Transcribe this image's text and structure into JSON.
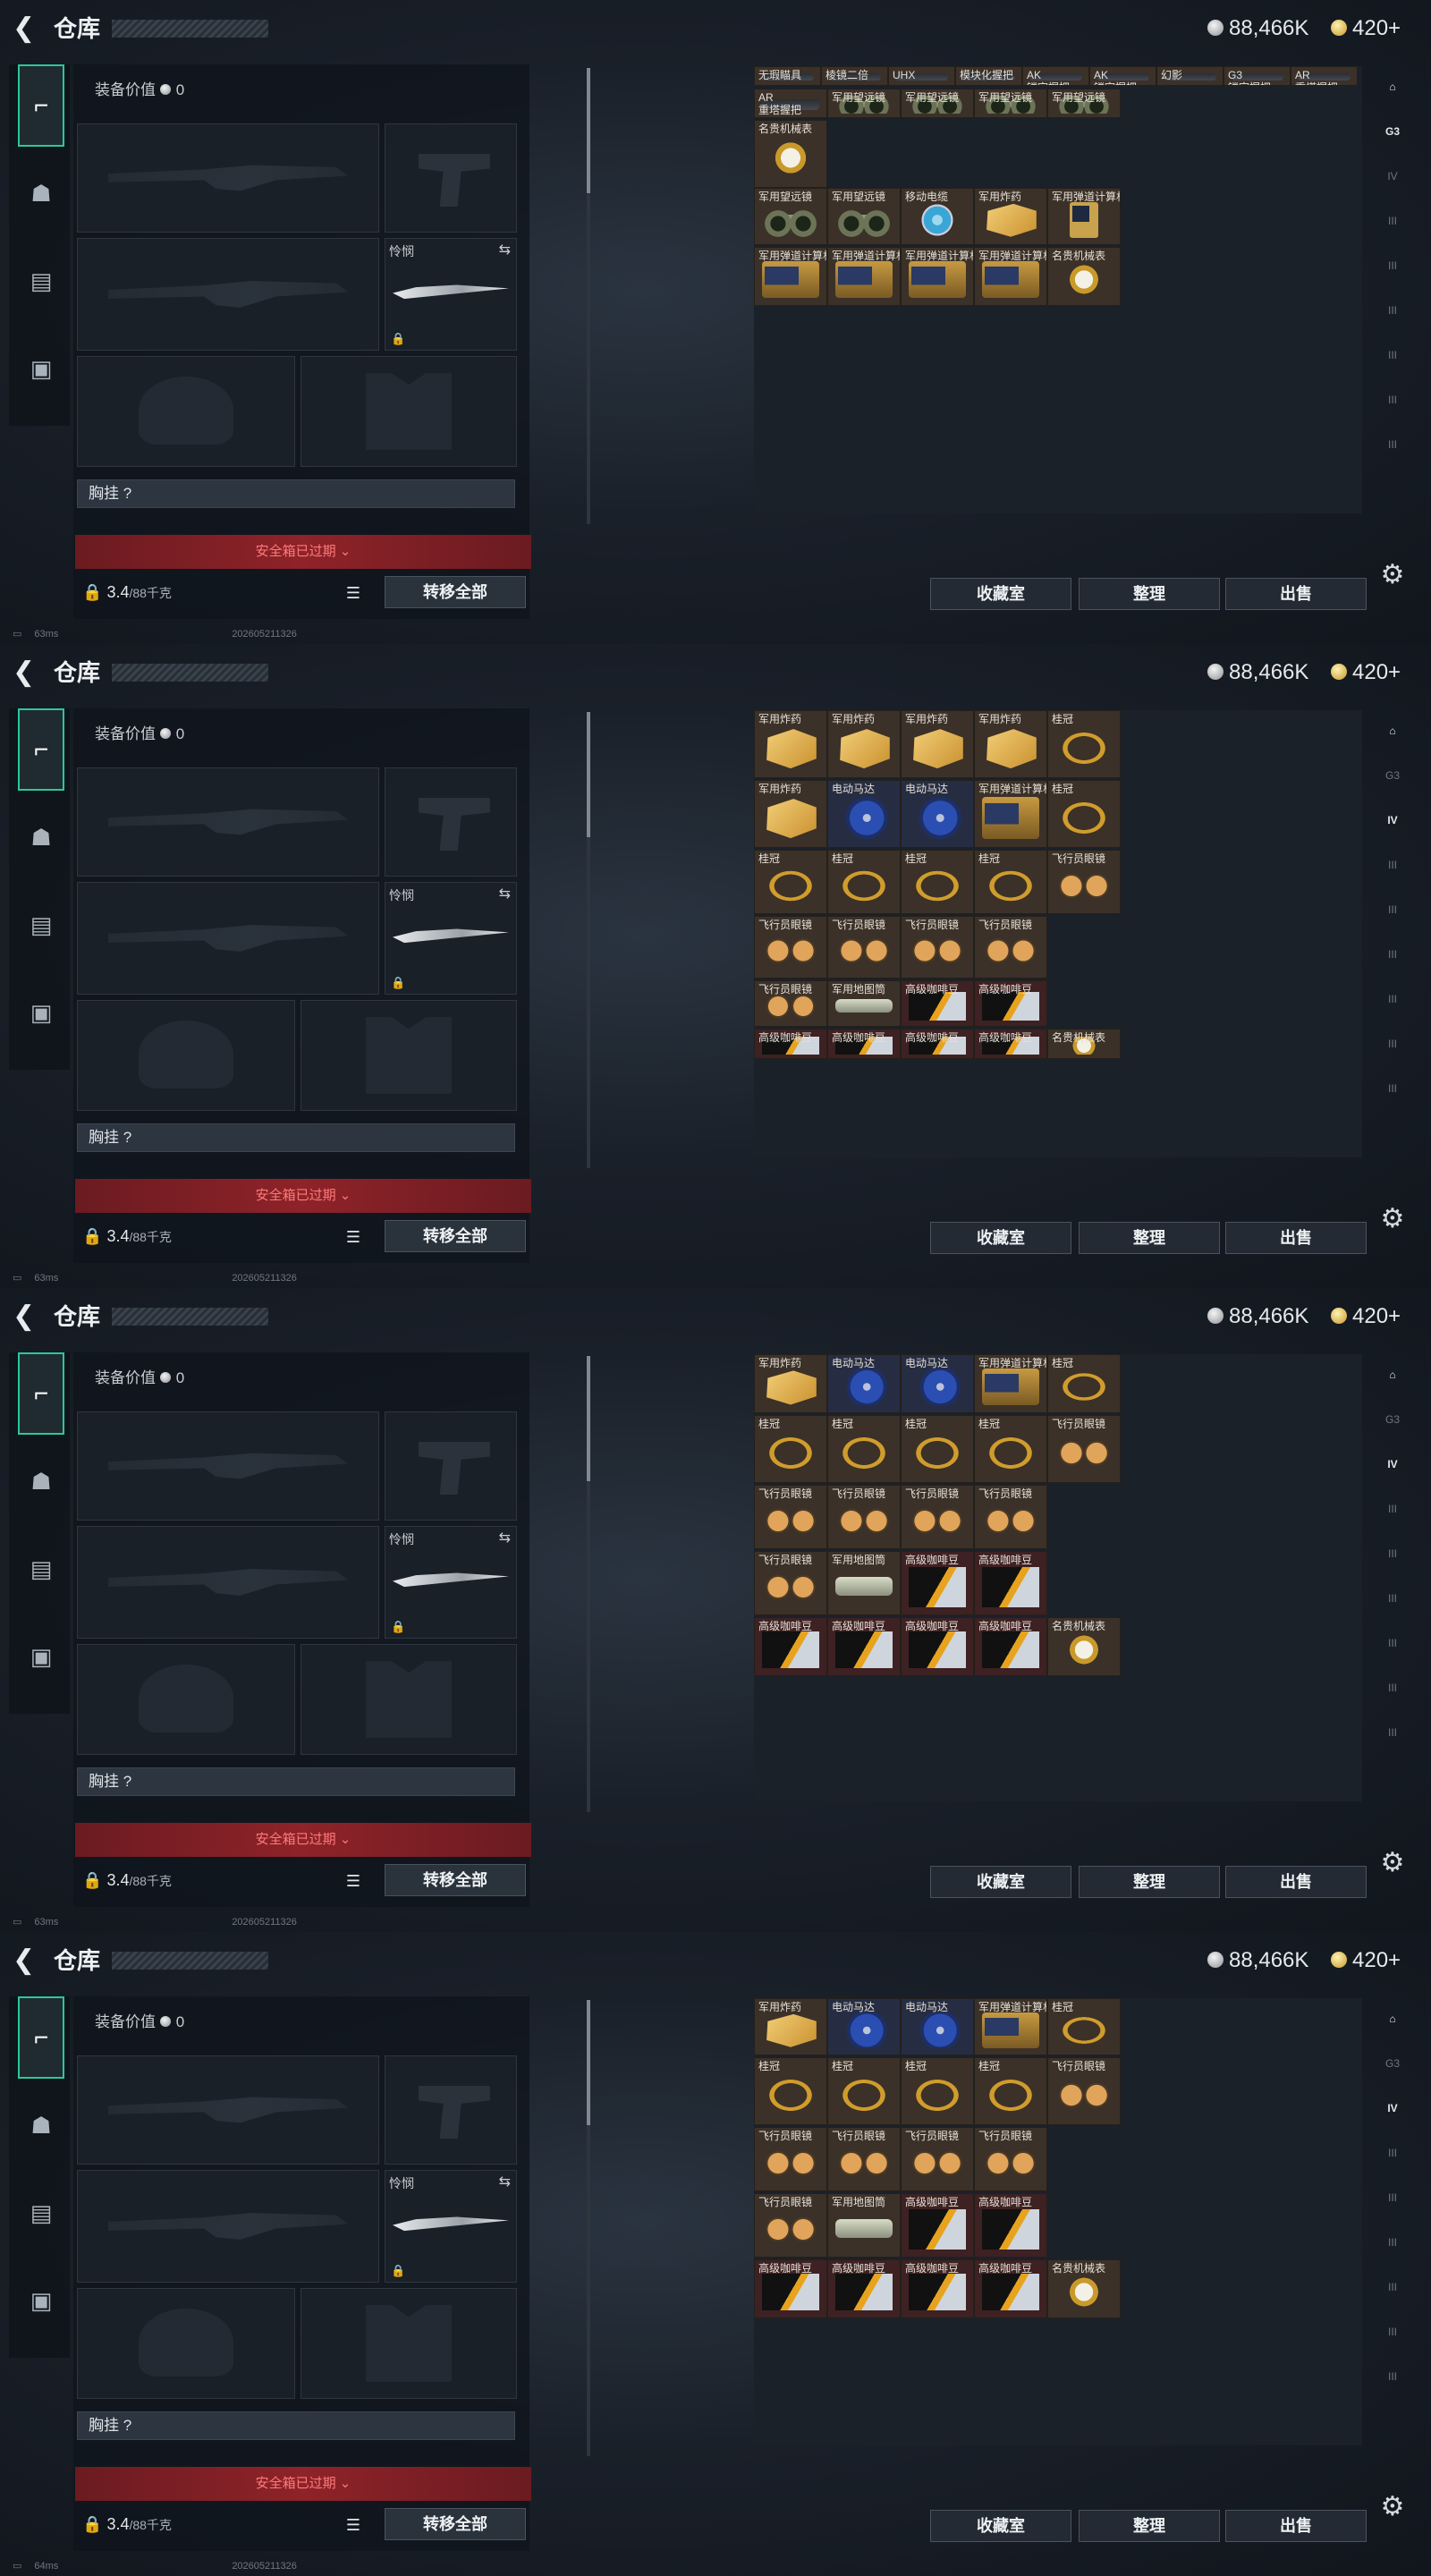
{
  "header": {
    "title": "仓库",
    "silver": "88,466K",
    "gold": "420+"
  },
  "gear": {
    "equip_value_label": "装备价值",
    "equip_value": "0",
    "melee_label": "怜悯",
    "chest_label": "胸挂 ?",
    "warning": "安全箱已过期",
    "weight": "3.4",
    "weight_max": "/88千克",
    "transfer_label": "转移全部"
  },
  "actions": {
    "collection": "收藏室",
    "organize": "整理",
    "sell": "出售"
  },
  "rail_labels": [
    "G3",
    "IV",
    "III",
    "III",
    "III",
    "III",
    "III",
    "III"
  ],
  "frames": [
    {
      "ping": "63ms",
      "time": "202605211326",
      "rows": [
        [
          {
            "n": "无瑕瞄具",
            "i": "att"
          },
          {
            "n": "棱镜二倍",
            "i": "att"
          },
          {
            "n": "UHX",
            "i": "att"
          },
          {
            "n": "模块化握把",
            "i": "att"
          },
          {
            "n": "AK\n镂空握把",
            "i": "att"
          },
          {
            "n": "AK\n镂空握把",
            "i": "att"
          },
          {
            "n": "幻影",
            "i": "att"
          },
          {
            "n": "G3\n镂空握把",
            "i": "att"
          },
          {
            "n": "AR\n重塔握把",
            "i": "att"
          }
        ],
        [
          {
            "n": "AR\n重塔握把",
            "i": "att"
          },
          {
            "n": "军用望远镜",
            "i": "bino"
          },
          {
            "n": "军用望远镜",
            "i": "bino"
          },
          {
            "n": "军用望远镜",
            "i": "bino"
          },
          {
            "n": "军用望远镜",
            "i": "bino"
          }
        ],
        [
          {
            "n": "名贵机械表",
            "i": "watch"
          }
        ],
        [
          {
            "n": "军用望远镜",
            "i": "bino"
          },
          {
            "n": "军用望远镜",
            "i": "bino"
          },
          {
            "n": "移动电缆",
            "i": "reel"
          },
          {
            "n": "军用炸药",
            "i": "crate"
          },
          {
            "n": "军用弹道计算机",
            "i": "meter"
          }
        ],
        [
          {
            "n": "军用弹道计算机",
            "i": "radio"
          },
          {
            "n": "军用弹道计算机",
            "i": "radio"
          },
          {
            "n": "军用弹道计算机",
            "i": "radio"
          },
          {
            "n": "军用弹道计算机",
            "i": "radio"
          },
          {
            "n": "名贵机械表",
            "i": "watch"
          }
        ]
      ]
    },
    {
      "ping": "63ms",
      "time": "202605211326",
      "rows": [
        [
          {
            "n": "军用炸药",
            "i": "crate"
          },
          {
            "n": "军用炸药",
            "i": "crate"
          },
          {
            "n": "军用炸药",
            "i": "crate"
          },
          {
            "n": "军用炸药",
            "i": "crate"
          },
          {
            "n": "桂冠",
            "i": "chain"
          }
        ],
        [
          {
            "n": "军用炸药",
            "i": "crate"
          },
          {
            "n": "电动马达",
            "i": "motor"
          },
          {
            "n": "电动马达",
            "i": "motor"
          },
          {
            "n": "军用弹道计算机",
            "i": "radio"
          },
          {
            "n": "桂冠",
            "i": "chain"
          }
        ],
        [
          {
            "n": "桂冠",
            "i": "chain"
          },
          {
            "n": "桂冠",
            "i": "chain"
          },
          {
            "n": "桂冠",
            "i": "chain"
          },
          {
            "n": "桂冠",
            "i": "chain"
          },
          {
            "n": "飞行员眼镜",
            "i": "glasses"
          }
        ],
        [
          {
            "n": "飞行员眼镜",
            "i": "glasses"
          },
          {
            "n": "飞行员眼镜",
            "i": "glasses"
          },
          {
            "n": "飞行员眼镜",
            "i": "glasses"
          },
          {
            "n": "飞行员眼镜",
            "i": "glasses"
          }
        ],
        [
          {
            "n": "飞行员眼镜",
            "i": "glasses"
          },
          {
            "n": "军用地图筒",
            "i": "tube"
          },
          {
            "n": "高级咖啡豆",
            "i": "coffee"
          },
          {
            "n": "高级咖啡豆",
            "i": "coffee"
          }
        ],
        [
          {
            "n": "高级咖啡豆",
            "i": "coffee"
          },
          {
            "n": "高级咖啡豆",
            "i": "coffee"
          },
          {
            "n": "高级咖啡豆",
            "i": "coffee"
          },
          {
            "n": "高级咖啡豆",
            "i": "coffee"
          },
          {
            "n": "名贵机械表",
            "i": "watch"
          }
        ]
      ]
    },
    {
      "ping": "63ms",
      "time": "202605211326",
      "rows": [
        [
          {
            "n": "军用炸药",
            "i": "crate"
          },
          {
            "n": "电动马达",
            "i": "motor"
          },
          {
            "n": "电动马达",
            "i": "motor"
          },
          {
            "n": "军用弹道计算机",
            "i": "radio"
          },
          {
            "n": "桂冠",
            "i": "chain"
          }
        ],
        [
          {
            "n": "桂冠",
            "i": "chain"
          },
          {
            "n": "桂冠",
            "i": "chain"
          },
          {
            "n": "桂冠",
            "i": "chain"
          },
          {
            "n": "桂冠",
            "i": "chain"
          },
          {
            "n": "飞行员眼镜",
            "i": "glasses"
          }
        ],
        [
          {
            "n": "飞行员眼镜",
            "i": "glasses"
          },
          {
            "n": "飞行员眼镜",
            "i": "glasses"
          },
          {
            "n": "飞行员眼镜",
            "i": "glasses"
          },
          {
            "n": "飞行员眼镜",
            "i": "glasses"
          }
        ],
        [
          {
            "n": "飞行员眼镜",
            "i": "glasses"
          },
          {
            "n": "军用地图筒",
            "i": "tube"
          },
          {
            "n": "高级咖啡豆",
            "i": "coffee"
          },
          {
            "n": "高级咖啡豆",
            "i": "coffee"
          }
        ],
        [
          {
            "n": "高级咖啡豆",
            "i": "coffee"
          },
          {
            "n": "高级咖啡豆",
            "i": "coffee"
          },
          {
            "n": "高级咖啡豆",
            "i": "coffee"
          },
          {
            "n": "高级咖啡豆",
            "i": "coffee"
          },
          {
            "n": "名贵机械表",
            "i": "watch"
          }
        ]
      ]
    },
    {
      "ping": "64ms",
      "time": "202605211326",
      "rows": [
        [
          {
            "n": "军用炸药",
            "i": "crate"
          },
          {
            "n": "电动马达",
            "i": "motor"
          },
          {
            "n": "电动马达",
            "i": "motor"
          },
          {
            "n": "军用弹道计算机",
            "i": "radio"
          },
          {
            "n": "桂冠",
            "i": "chain"
          }
        ],
        [
          {
            "n": "桂冠",
            "i": "chain"
          },
          {
            "n": "桂冠",
            "i": "chain"
          },
          {
            "n": "桂冠",
            "i": "chain"
          },
          {
            "n": "桂冠",
            "i": "chain"
          },
          {
            "n": "飞行员眼镜",
            "i": "glasses"
          }
        ],
        [
          {
            "n": "飞行员眼镜",
            "i": "glasses"
          },
          {
            "n": "飞行员眼镜",
            "i": "glasses"
          },
          {
            "n": "飞行员眼镜",
            "i": "glasses"
          },
          {
            "n": "飞行员眼镜",
            "i": "glasses"
          }
        ],
        [
          {
            "n": "飞行员眼镜",
            "i": "glasses"
          },
          {
            "n": "军用地图筒",
            "i": "tube"
          },
          {
            "n": "高级咖啡豆",
            "i": "coffee"
          },
          {
            "n": "高级咖啡豆",
            "i": "coffee"
          }
        ],
        [
          {
            "n": "高级咖啡豆",
            "i": "coffee"
          },
          {
            "n": "高级咖啡豆",
            "i": "coffee"
          },
          {
            "n": "高级咖啡豆",
            "i": "coffee"
          },
          {
            "n": "高级咖啡豆",
            "i": "coffee"
          },
          {
            "n": "名贵机械表",
            "i": "watch"
          }
        ]
      ]
    }
  ]
}
